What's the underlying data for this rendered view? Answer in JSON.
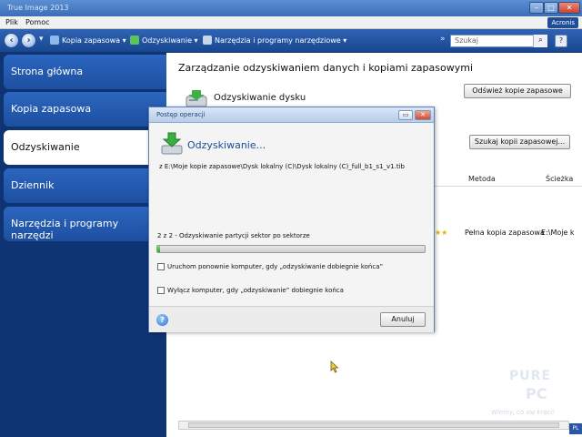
{
  "window": {
    "title": "True Image 2013",
    "brand": "Acronis"
  },
  "menu": [
    "Plik",
    "Pomoc"
  ],
  "toolbar": {
    "items": [
      "Kopia zapasowa",
      "Odzyskiwanie",
      "Narzędzia i programy narzędziowe"
    ],
    "search_placeholder": "Szukaj",
    "help": "?"
  },
  "sidebar": {
    "items": [
      "Strona główna",
      "Kopia zapasowa",
      "Odzyskiwanie",
      "Dziennik",
      "Narzędzia i programy narzędzi"
    ],
    "active_index": 2
  },
  "main": {
    "title": "Zarządzanie odzyskiwaniem danych i kopiami zapasowymi",
    "section": "Odzyskiwanie dysku",
    "refresh_button": "Odśwież kopie zapasowe",
    "find_button": "Szukaj kopii zapasowej...",
    "columns": [
      "Metoda",
      "Ścieżka"
    ],
    "row": {
      "method": "Pełna kopia zapasowa",
      "path": "E:\\Moje k"
    }
  },
  "dialog": {
    "title": "Postęp operacji",
    "heading": "Odzyskiwanie...",
    "path": "z E:\\Moje kopie zapasowe\\Dysk lokalny (C)\\Dysk lokalny (C)_full_b1_s1_v1.tib",
    "step": "2 z 2 - Odzyskiwanie partycji sektor po sektorze",
    "progress": 0.01,
    "options": [
      {
        "label": "Uruchom ponownie komputer, gdy „odzyskiwanie dobiegnie końca”",
        "checked": false
      },
      {
        "label": "Wyłącz komputer, gdy „odzyskiwanie” dobiegnie końca",
        "checked": false
      }
    ],
    "cancel": "Anuluj"
  },
  "watermark": {
    "line1": "PURE",
    "line2": "PC",
    "tagline": "Wiemy, co się kręci!"
  },
  "tray": {
    "lang": "PL"
  }
}
